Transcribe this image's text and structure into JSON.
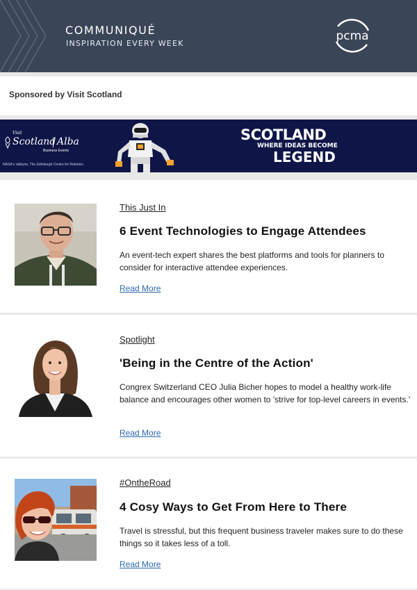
{
  "header": {
    "title": "COMMUNIQUÉ",
    "tagline": "INSPIRATION EVERY WEEK",
    "logo_text": "pcma",
    "background": "#3a4657"
  },
  "sponsor": {
    "label": "Sponsored by Visit Scotland"
  },
  "banner": {
    "visit": "Visit",
    "scotland": "Scotland",
    "alba": "Alba",
    "business_events": "Business Events",
    "caption": "NASA's Valkyrie, The Edinburgh Centre for Robotics",
    "headline": "SCOTLAND",
    "subheadline": "WHERE IDEAS BECOME",
    "legend": "LEGEND",
    "background": "#0f1547"
  },
  "articles": [
    {
      "category": "This Just In",
      "title": "6 Event Technologies to Engage Attendees",
      "description": "An event-tech expert shares the best platforms and tools for planners to consider for interactive attendee experiences.",
      "link": "Read More"
    },
    {
      "category": "Spotlight",
      "title": "'Being in the Centre of the Action'",
      "description": "Congrex Switzerland CEO Julia Bicher hopes to model a healthy work-life balance and encourages other women to 'strive for top-level careers in events.'",
      "link": "Read More"
    },
    {
      "category": "#OntheRoad",
      "title": "4 Cosy Ways to Get From Here to There",
      "description": "Travel is stressful, but this frequent business traveler makes sure to do these things so it takes less of a toll.",
      "link": "Read More"
    }
  ],
  "colors": {
    "link": "#2e67b1",
    "page_bg": "#e8e8e8"
  }
}
